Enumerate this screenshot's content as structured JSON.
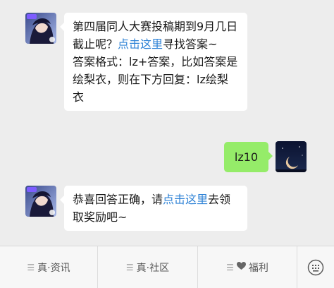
{
  "messages": [
    {
      "side": "left",
      "avatar": "game-character-avatar",
      "text_before": "第四届同人大赛投稿期到9月几日截止呢？",
      "link": "点击这里",
      "text_after": "寻找答案~",
      "line2": "答案格式：lz+答案，比如答案是绘梨衣，则在下方回复：lz绘梨衣"
    },
    {
      "side": "right",
      "avatar": "moon-night-avatar",
      "text": "lz10"
    },
    {
      "side": "left",
      "avatar": "game-character-avatar",
      "text_before": "恭喜回答正确，请",
      "link": "点击这里",
      "text_after": "去领取奖励吧~"
    }
  ],
  "bottom_menu": {
    "items": [
      {
        "label": "真·资讯",
        "icon": "menu-lines-icon"
      },
      {
        "label": "真·社区",
        "icon": "menu-lines-icon"
      },
      {
        "label": "福利",
        "icon": "heart-icon"
      }
    ],
    "keyboard_icon": "keyboard-icon"
  },
  "colors": {
    "background": "#ededed",
    "bubble_left": "#ffffff",
    "bubble_right": "#95ec69",
    "link": "#2e82d6"
  }
}
